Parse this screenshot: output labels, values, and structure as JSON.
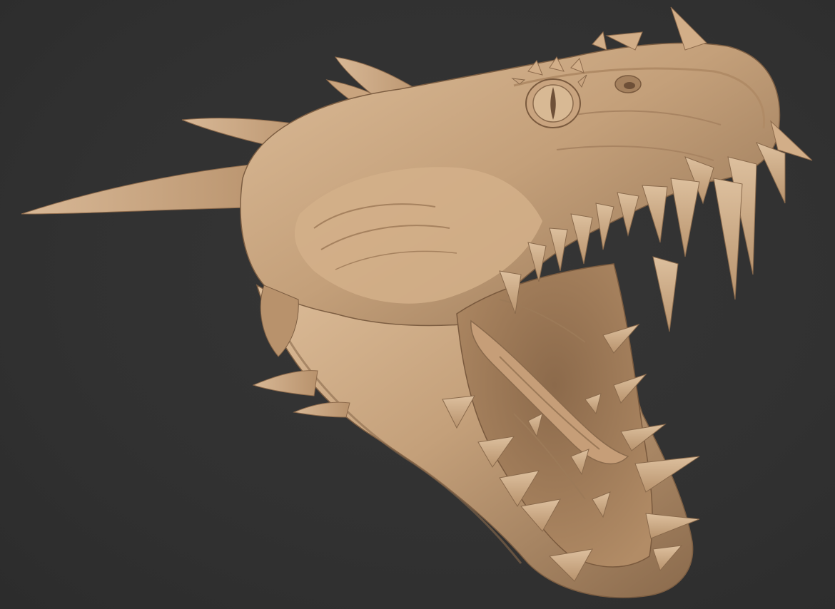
{
  "scene": {
    "subject": "dragon-head-sculpt",
    "background_color": "#303030",
    "material_base_color": "#c9a57f",
    "material_shadow_color": "#7a5c40",
    "material_highlight_color": "#e8cfae"
  }
}
